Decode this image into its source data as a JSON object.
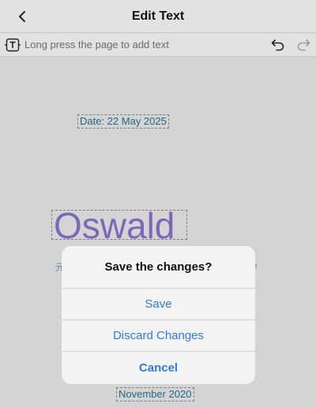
{
  "header": {
    "title": "Edit Text",
    "back_icon": "chevron-left-icon"
  },
  "toolbar": {
    "text_tool_icon": "text-tool-icon",
    "hint": "Long press the page to add text",
    "undo_icon": "undo-icon",
    "redo_icon": "redo-icon"
  },
  "canvas": {
    "date_text": "Date: 22 May 2025",
    "name_text": "Oswald",
    "bottom_text": "November 2020",
    "peek_left": "元",
    "peek_right": "e"
  },
  "dialog": {
    "title": "Save the changes?",
    "save_label": "Save",
    "discard_label": "Discard Changes",
    "cancel_label": "Cancel"
  },
  "colors": {
    "accent": "#2f7be5",
    "name_text": "#7b68b8",
    "field_text": "#1f6a86"
  }
}
